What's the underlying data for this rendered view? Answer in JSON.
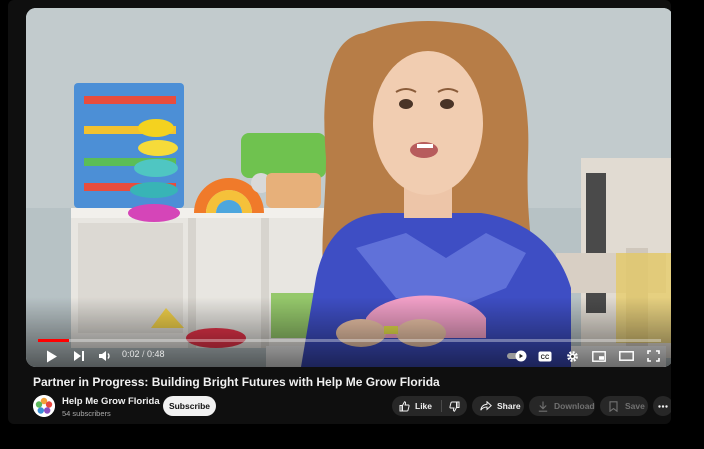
{
  "player": {
    "current_time": "0:02",
    "time_separator": " / ",
    "duration": "0:48",
    "progress": 0.05,
    "progress_color": "#ff0000"
  },
  "video": {
    "title": "Partner in Progress: Building Bright Futures with Help Me Grow Florida"
  },
  "channel": {
    "name": "Help Me Grow Florida",
    "subscribers": "54 subscribers",
    "subscribe_label": "Subscribe"
  },
  "actions": {
    "like_label": "Like",
    "share_label": "Share",
    "download_label": "Download",
    "save_label": "Save"
  },
  "icons": {
    "play": "play-icon",
    "next": "next-icon",
    "volume": "volume-icon",
    "autoplay": "autoplay-toggle-icon",
    "captions": "captions-icon",
    "settings": "gear-icon",
    "miniplayer": "miniplayer-icon",
    "theater": "theater-mode-icon",
    "fullscreen": "fullscreen-icon",
    "like": "thumbs-up-icon",
    "dislike": "thumbs-down-icon",
    "share": "share-icon",
    "download": "download-icon",
    "save": "save-icon",
    "more": "more-icon"
  }
}
